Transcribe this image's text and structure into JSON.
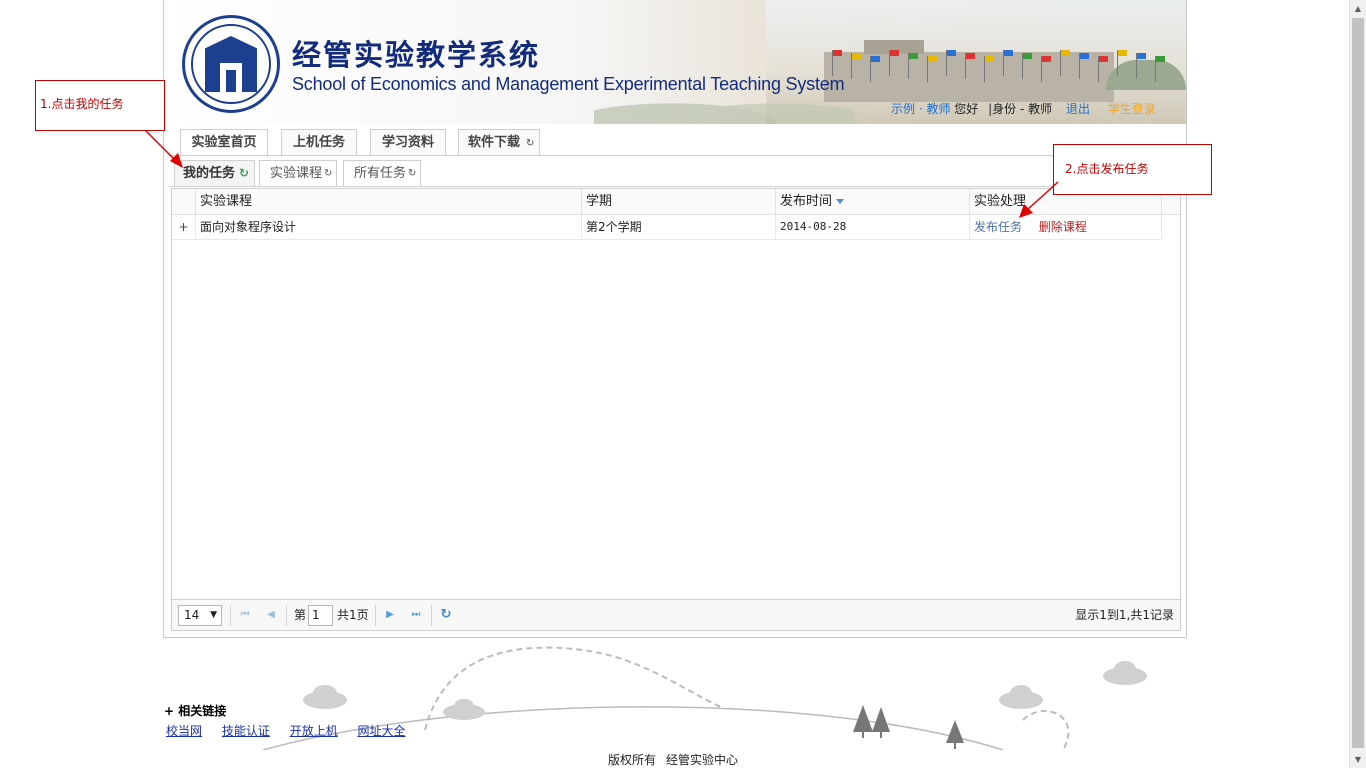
{
  "header": {
    "title_cn": "经管实验教学系统",
    "title_en": "School of Economics and Management Experimental Teaching System",
    "user_name": "示例 · 教师",
    "greeting": "您好",
    "identity": "|身份 - 教师",
    "logout": "退出",
    "extra_link": "学生登录"
  },
  "main_tabs": [
    "实验室首页",
    "上机任务",
    "学习资料",
    "软件下载"
  ],
  "sub_tabs": [
    "我的任务",
    "实验课程",
    "所有任务"
  ],
  "grid": {
    "columns": [
      "实验课程",
      "学期",
      "发布时间",
      "实验处理"
    ],
    "rows": [
      {
        "expander": "+",
        "course": "面向对象程序设计",
        "term": "第2个学期",
        "date": "2014-08-28",
        "action_publish": "发布任务",
        "action_delete": "删除课程"
      }
    ]
  },
  "pager": {
    "page_size": "14",
    "page_prefix": "第",
    "page_number": "1",
    "page_total": "共1页",
    "info": "显示1到1,共1记录"
  },
  "annotations": {
    "step1": "1.点击我的任务",
    "step2": "2.点击发布任务"
  },
  "footer": {
    "links_title": "+  相关链接",
    "links": [
      "校当网",
      "技能认证",
      "开放上机",
      "网址大全"
    ],
    "copyright_1": "版权所有",
    "copyright_2": "经管实验中心"
  },
  "colors": {
    "brand_blue": "#132b7c",
    "link_blue": "#1d6fd0",
    "annotation_red": "#c00000",
    "delete_red": "#b22222"
  }
}
